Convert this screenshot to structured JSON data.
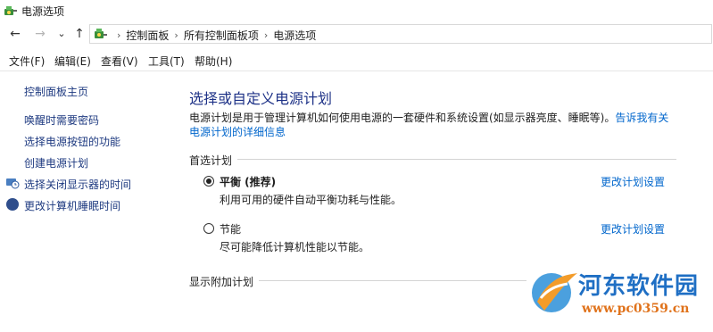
{
  "window": {
    "title": "电源选项"
  },
  "nav": {
    "back": "←",
    "forward": "→",
    "recent": "⌄",
    "up": "↑",
    "breadcrumbs": [
      "控制面板",
      "所有控制面板项",
      "电源选项"
    ]
  },
  "menu": [
    "文件(F)",
    "编辑(E)",
    "查看(V)",
    "工具(T)",
    "帮助(H)"
  ],
  "sidebar": {
    "home": "控制面板主页",
    "items": [
      "唤醒时需要密码",
      "选择电源按钮的功能",
      "创建电源计划",
      "选择关闭显示器的时间",
      "更改计算机睡眠时间"
    ]
  },
  "main": {
    "title": "选择或自定义电源计划",
    "description": "电源计划是用于管理计算机如何使用电源的一套硬件和系统设置(如显示器亮度、睡眠等)。",
    "description_link": "告诉我有关电源计划的详细信息",
    "preferred_label": "首选计划",
    "plans": [
      {
        "name": "平衡 (推荐)",
        "desc": "利用可用的硬件自动平衡功耗与性能。",
        "link": "更改计划设置",
        "selected": true
      },
      {
        "name": "节能",
        "desc": "尽可能降低计算机性能以节能。",
        "link": "更改计划设置",
        "selected": false
      }
    ],
    "additional_label": "显示附加计划"
  },
  "watermark": {
    "name": "河东软件园",
    "url": "www.pc0359.cn"
  },
  "colors": {
    "link": "#0066cc",
    "title": "#1e3287",
    "watermark_blue": "#1f6fc4",
    "watermark_orange": "#e0731c"
  }
}
